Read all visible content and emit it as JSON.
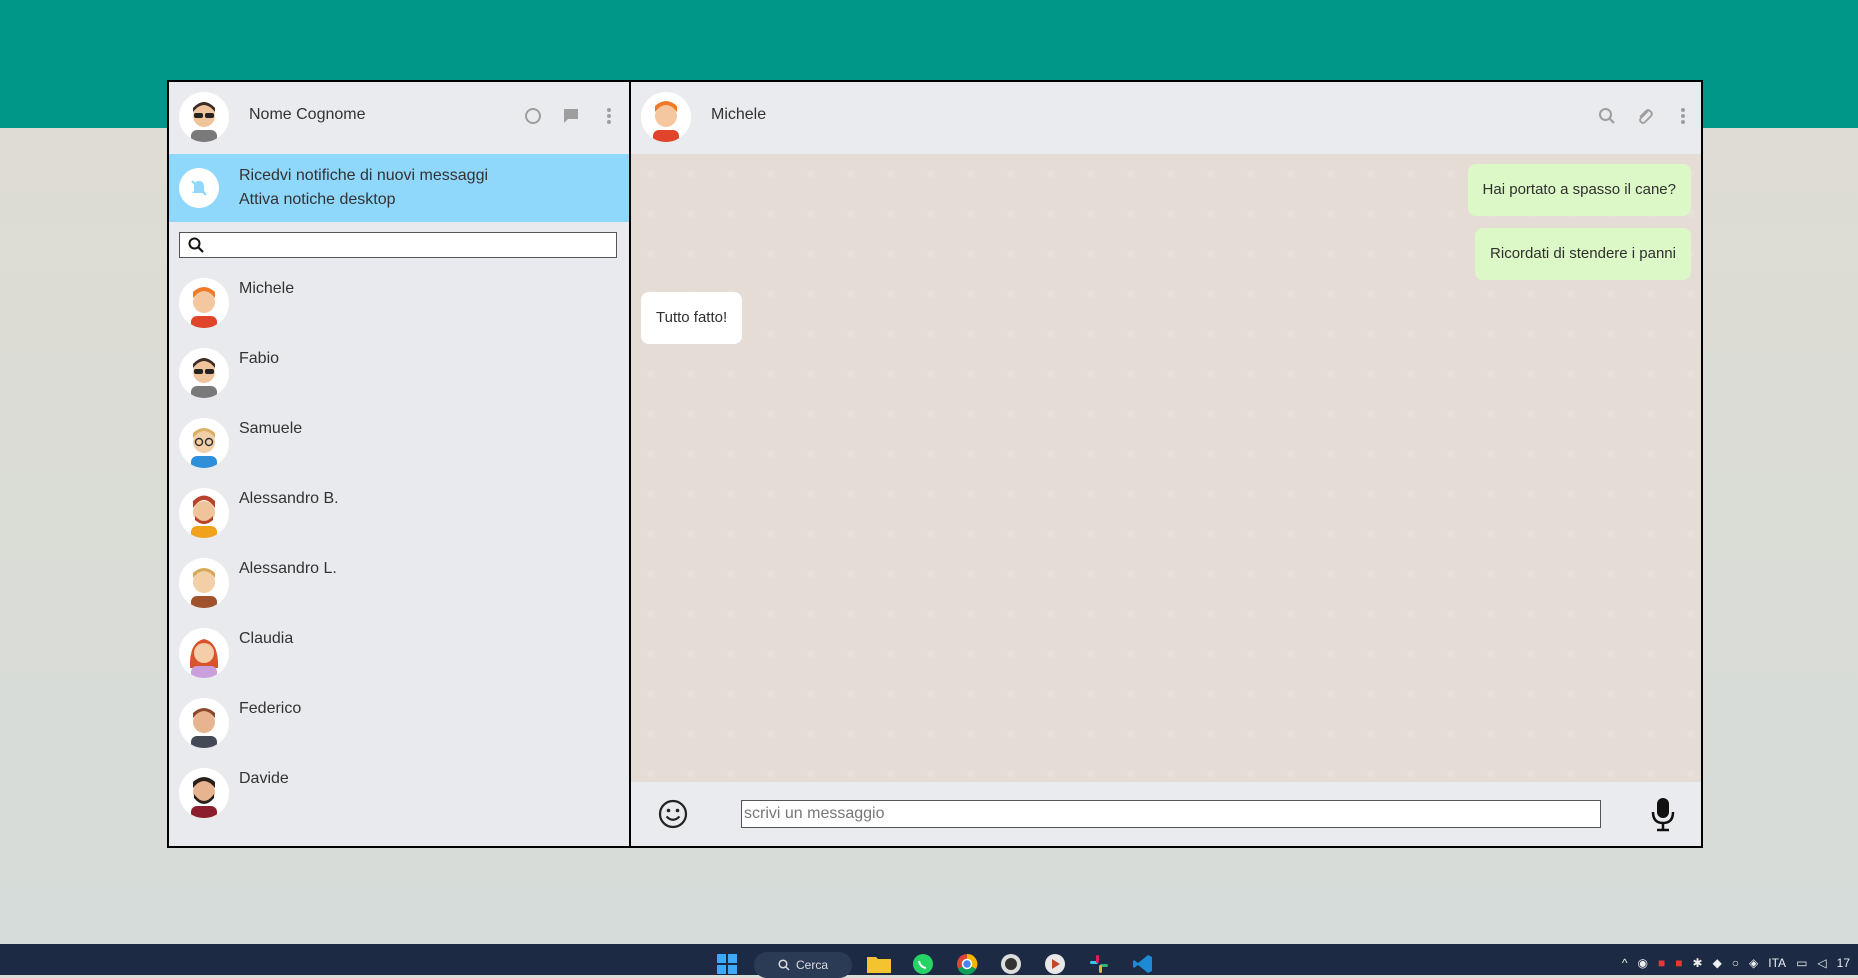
{
  "sidebar": {
    "user_name": "Nome Cognome",
    "notification": {
      "line1": "Ricedvi notifiche di nuovi messaggi",
      "line2": "Attiva notiche desktop"
    },
    "search_placeholder": "",
    "contacts": [
      {
        "name": "Michele"
      },
      {
        "name": "Fabio"
      },
      {
        "name": "Samuele"
      },
      {
        "name": "Alessandro B."
      },
      {
        "name": "Alessandro L."
      },
      {
        "name": "Claudia"
      },
      {
        "name": "Federico"
      },
      {
        "name": "Davide"
      }
    ]
  },
  "chat": {
    "contact_name": "Michele",
    "messages": [
      {
        "text": "Hai portato a spasso il cane?",
        "direction": "sent"
      },
      {
        "text": "Ricordati di stendere i panni",
        "direction": "sent"
      },
      {
        "text": "Tutto fatto!",
        "direction": "received"
      }
    ],
    "input_placeholder": "scrivi un messaggio"
  },
  "taskbar": {
    "search_label": "Cerca",
    "lang": "ITA",
    "time_fragment": "17"
  },
  "colors": {
    "brand": "#009688",
    "notification_bg": "#8fd7fb",
    "sent_bubble": "#dcf8c6",
    "received_bubble": "#ffffff",
    "chat_bg": "#e5ddd5"
  }
}
